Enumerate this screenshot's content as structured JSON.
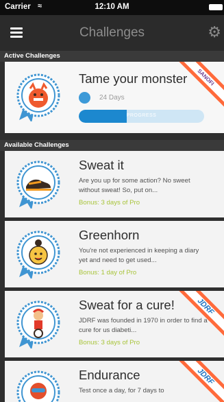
{
  "status_bar": {
    "carrier": "Carrier",
    "time": "12:10 AM"
  },
  "navbar": {
    "title": "Challenges",
    "menu_icon": "hamburger-icon",
    "settings_icon": "gear-icon"
  },
  "sections": {
    "active": "Active Challenges",
    "available": "Available Challenges"
  },
  "active_challenge": {
    "title": "Tame your monster",
    "days": "24 Days",
    "progress_label": "PROGRESS",
    "progress": 0.38,
    "sponsor": "SANOFI"
  },
  "available_challenges": [
    {
      "title": "Sweat it",
      "description": "Are you up for some action? No sweet without sweat! So, put on...",
      "bonus": "Bonus: 3 days of Pro"
    },
    {
      "title": "Greenhorn",
      "description": "You're not experienced in keeping a diary yet and need to get used...",
      "bonus": "Bonus: 1 day of Pro"
    },
    {
      "title": "Sweat for a cure!",
      "description": "JDRF was founded in 1970 in order to find a cure for us diabeti...",
      "bonus": "Bonus: 3 days of Pro",
      "sponsor": "JDRF"
    },
    {
      "title": "Endurance",
      "description": "Test once a day, for 7 days to",
      "sponsor": "JDRF"
    }
  ],
  "colors": {
    "accent": "#1c88cf",
    "bonus": "#a8c43a",
    "ribbon": "#ff6a3b"
  }
}
